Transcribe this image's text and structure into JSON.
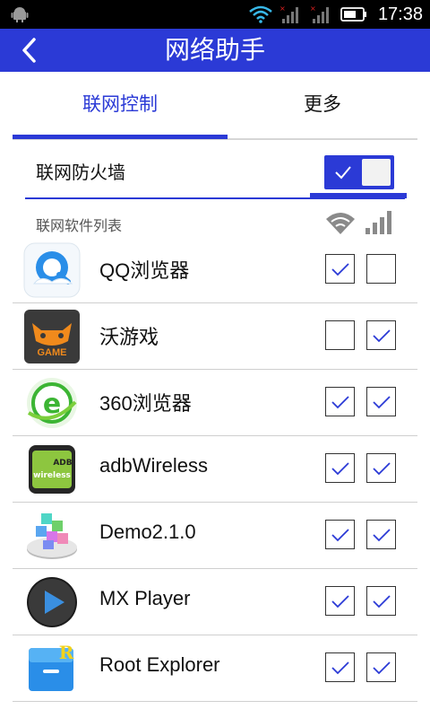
{
  "status_bar": {
    "time": "17:38"
  },
  "header": {
    "title": "网络助手"
  },
  "tabs": [
    {
      "label": "联网控制",
      "active": true
    },
    {
      "label": "更多",
      "active": false
    }
  ],
  "firewall": {
    "label": "联网防火墙",
    "enabled": true
  },
  "list_header": {
    "label": "联网软件列表"
  },
  "apps": [
    {
      "name": "QQ浏览器",
      "icon": "qq-browser-icon",
      "wifi": true,
      "data": false
    },
    {
      "name": "沃游戏",
      "icon": "wo-game-icon",
      "wifi": false,
      "data": true
    },
    {
      "name": "360浏览器",
      "icon": "browser-360-icon",
      "wifi": true,
      "data": true
    },
    {
      "name": "adbWireless",
      "icon": "adb-wireless-icon",
      "wifi": true,
      "data": true
    },
    {
      "name": "Demo2.1.0",
      "icon": "demo-cube-icon",
      "wifi": true,
      "data": true
    },
    {
      "name": "MX Player",
      "icon": "mx-player-icon",
      "wifi": true,
      "data": true
    },
    {
      "name": "Root Explorer",
      "icon": "root-explorer-icon",
      "wifi": true,
      "data": true
    }
  ],
  "colors": {
    "accent": "#2b3ad6",
    "check": "#2b3ad6"
  }
}
